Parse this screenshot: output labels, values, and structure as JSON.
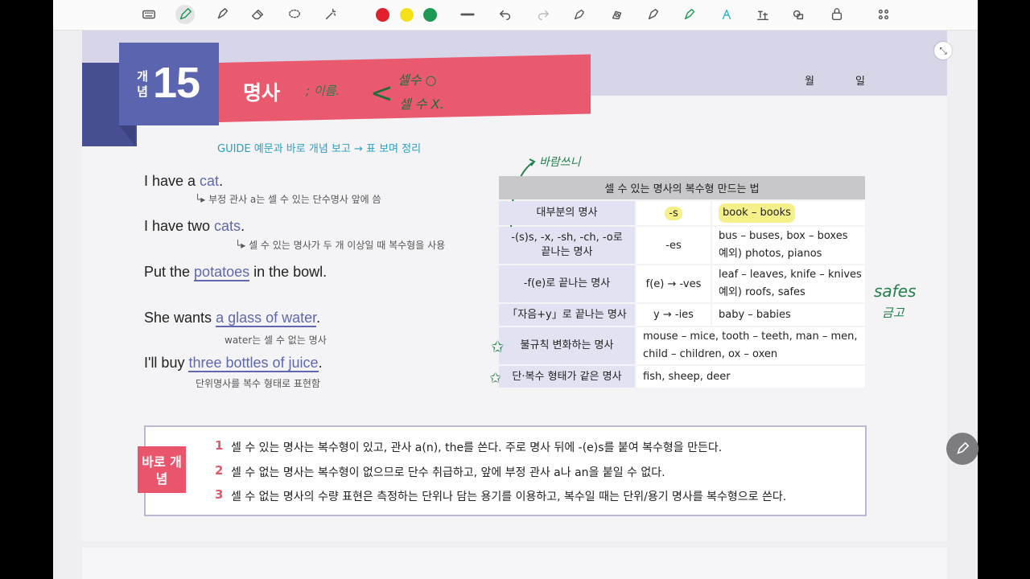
{
  "toolbar": {
    "tools": [
      "keyboard-icon",
      "pen-icon",
      "highlighter-icon",
      "eraser-icon",
      "lasso-icon",
      "magic-icon"
    ],
    "colors": [
      "#e0202a",
      "#f5e11a",
      "#1e9a54"
    ],
    "actions": [
      "line-width-icon",
      "undo-icon",
      "redo-icon",
      "shape-pen-icon",
      "shape-fill-icon",
      "shape-select-icon",
      "highlight-pen-icon",
      "text-icon",
      "ocr-icon",
      "shapes-icon",
      "lock-icon",
      "more-icon"
    ]
  },
  "header": {
    "label": "개념",
    "number": "15",
    "title": "명사",
    "hand_note1": "; 이름.",
    "hand_note2": "셀수 ○",
    "hand_note3": "셀 수 X.",
    "month": "월",
    "day": "일"
  },
  "guide": {
    "prefix": "GUIDE",
    "text": "예문과 바로 개념 보고 → 표 보며 정리"
  },
  "examples": [
    {
      "pre": "I have a ",
      "hl": "cat",
      "post": ".",
      "note": "└▸ 부정 관사 a는 셀 수 있는 단수명사 앞에 씀"
    },
    {
      "pre": "I have two ",
      "hl": "cats",
      "post": ".",
      "note": "└▸ 셀 수 있는 명사가 두 개 이상일 때 복수형을 사용"
    },
    {
      "pre": "Put the ",
      "hl": "potatoes",
      "post": " in the bowl.",
      "note": ""
    },
    {
      "pre": "She wants ",
      "hl": "a glass of water",
      "post": ".",
      "note": "water는 셀 수 없는 명사"
    },
    {
      "pre": "I'll buy ",
      "hl": "three bottles of juice",
      "post": ".",
      "note": "단위명사를 복수 형태로 표현함"
    }
  ],
  "table": {
    "title": "셀 수 있는 명사의 복수형 만드는 법",
    "hand_top": "바람쓰니",
    "rows": [
      {
        "label": "대부분의 명사",
        "rule": "-s",
        "ex1": "book – books",
        "ex2": ""
      },
      {
        "label": "-(s)s, -x, -sh, -ch, -o로 끝나는 명사",
        "rule": "-es",
        "ex1": "bus – buses, box – boxes",
        "ex2": "예외) photos, pianos"
      },
      {
        "label": "-f(e)로 끝나는 명사",
        "rule": "f(e) → -ves",
        "ex1": "leaf – leaves, knife – knives",
        "ex2": "예외) roofs, safes"
      },
      {
        "label": "「자음+y」로 끝나는 명사",
        "rule": "y → -ies",
        "ex1": "baby – babies",
        "ex2": ""
      },
      {
        "label": "불규칙 변화하는 명사",
        "rule": "",
        "ex1": "mouse – mice, tooth – teeth, man – men,",
        "ex2": "child – children, ox – oxen"
      },
      {
        "label": "단·복수 형태가 같은 명사",
        "rule": "",
        "ex1": "fish, sheep, deer",
        "ex2": ""
      }
    ],
    "hand_side1": "safes",
    "hand_side2": "금고"
  },
  "summary": {
    "tab": "바로 개념",
    "lines": [
      {
        "num": "1",
        "text": "셀 수 있는 명사는 복수형이 있고, 관사 a(n), the를 쓴다. 주로 명사 뒤에 -(e)s를 붙여 복수형을 만든다."
      },
      {
        "num": "2",
        "text": "셀 수 없는 명사는 복수형이 없으므로 단수 취급하고, 앞에 부정 관사 a나 an을 붙일 수 없다."
      },
      {
        "num": "3",
        "text": "셀 수 없는 명사의 수량 표현은 측정하는 단위나 담는 용기를 이용하고, 복수일 때는 단위/용기 명사를 복수형으로 쓴다."
      }
    ]
  }
}
